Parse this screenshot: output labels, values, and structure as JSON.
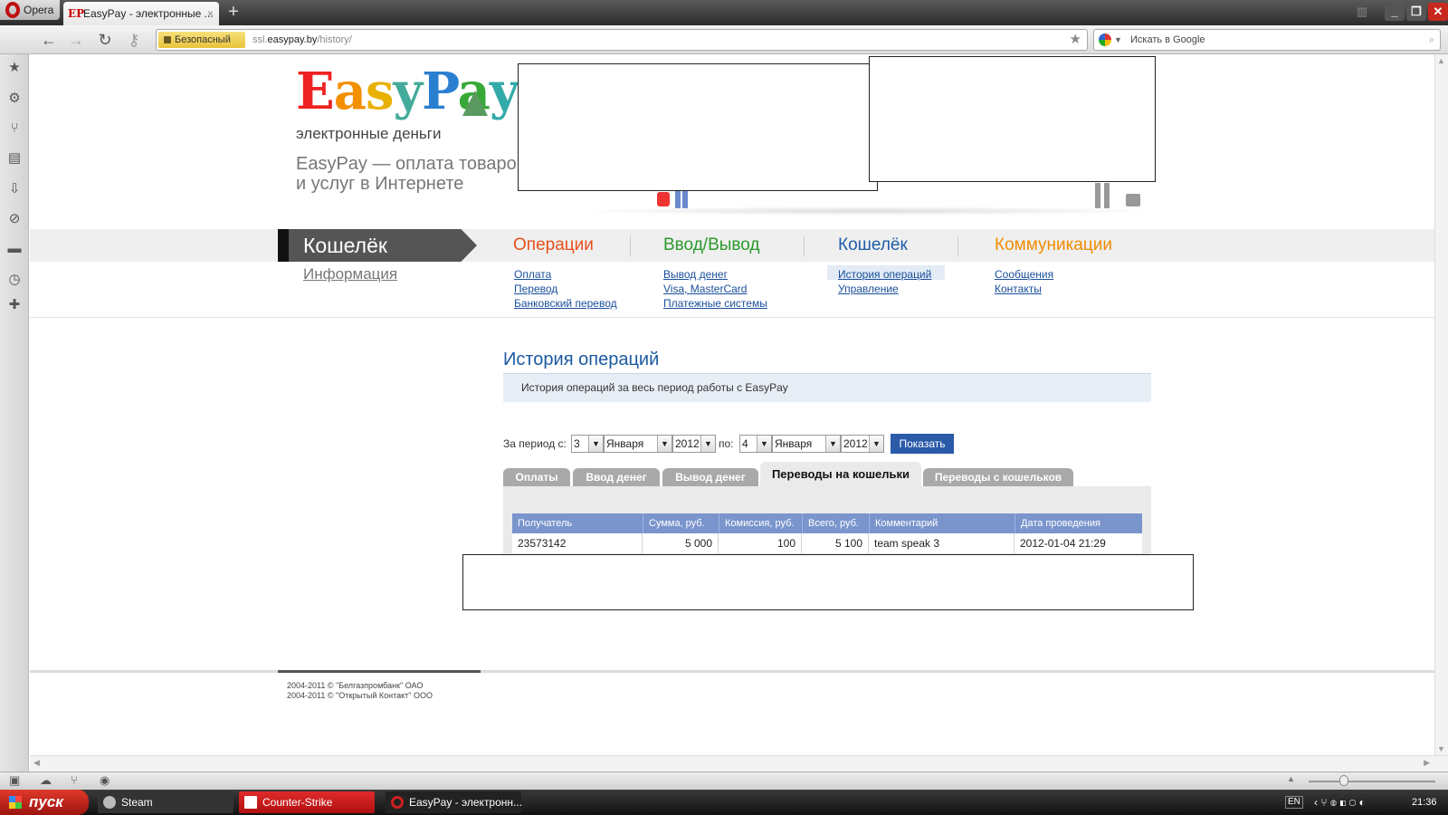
{
  "browser": {
    "opera_label": "Opera",
    "tab_title": "EasyPay - электронные ...",
    "tab_favicon": "EP",
    "tab_close": "×",
    "new_tab": "+",
    "security_label": "Безопасный",
    "url_prefix": "ssl.",
    "url_domain": "easypay.by",
    "url_path": "/history/",
    "search_placeholder": "Искать в Google"
  },
  "site": {
    "logo_letters": [
      "E",
      "a",
      "s",
      "y",
      "P",
      "a",
      "y"
    ],
    "slogan": "электронные деньги",
    "tagline": "EasyPay — оплата товаров и услуг в Интернете",
    "active_section": "Кошелёк",
    "info_link": "Информация",
    "menu": [
      {
        "title": "Операции",
        "color": "#e8501c",
        "items": [
          "Оплата",
          "Перевод",
          "Банковский перевод"
        ]
      },
      {
        "title": "Ввод/Вывод",
        "color": "#2b9a2b",
        "items": [
          "Вывод денег",
          "Visa, MasterCard",
          "Платежные системы"
        ]
      },
      {
        "title": "Кошелёк",
        "color": "#1f5ea8",
        "items": [
          "История операций",
          "Управление"
        ]
      },
      {
        "title": "Коммуникации",
        "color": "#f08c00",
        "items": [
          "Сообщения",
          "Контакты"
        ]
      }
    ]
  },
  "history": {
    "heading": "История операций",
    "info": "История операций за весь период работы с EasyPay",
    "period_label": "За период с:",
    "to_label": "по:",
    "from_day": "3",
    "from_month": "Января",
    "from_year": "2012",
    "to_day": "4",
    "to_month": "Января",
    "to_year": "2012",
    "show_button": "Показать",
    "tabs": [
      "Оплаты",
      "Ввод денег",
      "Вывод денег",
      "Переводы на кошельки",
      "Переводы с кошельков"
    ],
    "active_tab": "Переводы на кошельки",
    "columns": [
      "Получатель",
      "Сумма, руб.",
      "Комиссия, руб.",
      "Всего, руб.",
      "Комментарий",
      "Дата проведения"
    ],
    "rows": [
      [
        "23573142",
        "5 000",
        "100",
        "5 100",
        "team speak 3",
        "2012-01-04 21:29"
      ]
    ]
  },
  "footer": {
    "copy1": "2004-2011 © \"Белгазпромбанк\" ОАО",
    "copy2": "2004-2011 © \"Открытый Контакт\" ООО"
  },
  "taskbar": {
    "start": "пуск",
    "items": [
      "Steam",
      "Counter-Strike",
      "EasyPay - электронн..."
    ],
    "lang": "EN",
    "time": "21:36"
  }
}
